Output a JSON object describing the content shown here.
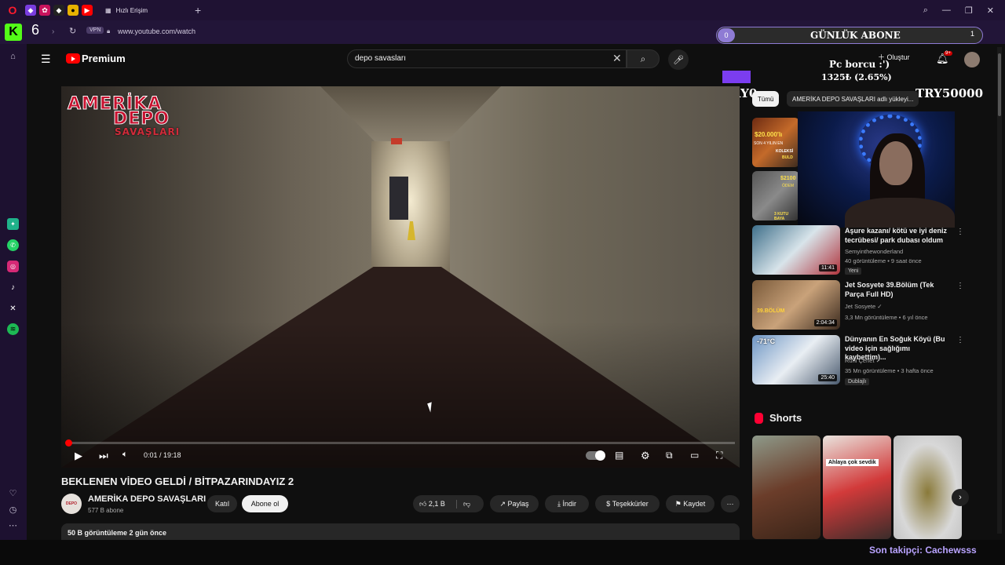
{
  "browser": {
    "tab_label": "Hızlı Erişim",
    "url": "www.youtube.com/watch",
    "vpn": "VPN",
    "kick_letter": "K",
    "workspace_number": "6"
  },
  "header": {
    "brand": "Premium",
    "search_value": "depo savasları",
    "create_label": "Oluştur",
    "notifications_badge": "9+"
  },
  "overlay": {
    "counter_left": "0",
    "title": "GÜNLÜK ABONE",
    "counter_right": "1",
    "pc_label": "Pc borcu :')",
    "progress_text": "1325₺ (2.65%)",
    "progress_fraction": 0.0265,
    "try_left": "TRY0",
    "try_right": "TRY50000",
    "last_follower": "Son takipçi: Cachewsss"
  },
  "player": {
    "watermark": [
      "AMERİKA",
      "DEPO",
      "SAVAŞLARI"
    ],
    "time": "0:01 / 19:18",
    "progress_fraction": 0.001
  },
  "video": {
    "title": "BEKLENEN VİDEO GELDİ / BİTPAZARINDAYIZ 2",
    "channel": "AMERİKA DEPO SAVAŞLARI",
    "subscribers": "577 B abone",
    "join_label": "Katıl",
    "subscribe_label": "Abone ol",
    "likes": "2,1 B",
    "share_label": "Paylaş",
    "download_label": "İndir",
    "thanks_label": "Teşekkürler",
    "save_label": "Kaydet",
    "views_date": "50 B görüntüleme  2 gün önce"
  },
  "chips": {
    "all": "Tümü",
    "related": "AMERİKA DEPO SAVAŞLARI adlı yükleyi..."
  },
  "recommendations": [
    {
      "title": "Aşure kazanı/ kötü ve iyi deniz tecrübesi/ park dubası oldum",
      "channel": "Semyinthewonderland",
      "meta": "40 görüntüleme • 9 saat önce",
      "badge": "Yeni",
      "duration": "11:41"
    },
    {
      "title": "Jet Sosyete 39.Bölüm (Tek Parça Full HD)",
      "channel": "Jet Sosyete ✓",
      "meta": "3,3 Mn görüntüleme • 6 yıl önce",
      "badge": "",
      "duration": "2:04:34"
    },
    {
      "title": "Dünyanın En Soğuk Köyü (Bu video için sağlığımı kaybettim)...",
      "channel": "Ruhi Çenet ✓",
      "meta": "35 Mn görüntüleme • 3 hafta önce",
      "badge": "Dublajlı",
      "duration": "25:40"
    }
  ],
  "thumb_texts": {
    "top1": "$20.000'lı",
    "top1b": "SON 4 YILIN EN",
    "top1c": "KOLEKSİ",
    "top1d": "BULD",
    "top2": "$2100",
    "top2b": "ÖDEM",
    "top2c": "3 KUTU BAYA",
    "cold": "-71°C",
    "jet": "39.BÖLÜM"
  },
  "shorts": {
    "title": "Shorts",
    "card2_text": "Ahlaya çok sevdik"
  },
  "colors": {
    "accent_red": "#ff0000",
    "overlay_purple": "#7b3df0",
    "follower_text": "#b9a3ff"
  }
}
